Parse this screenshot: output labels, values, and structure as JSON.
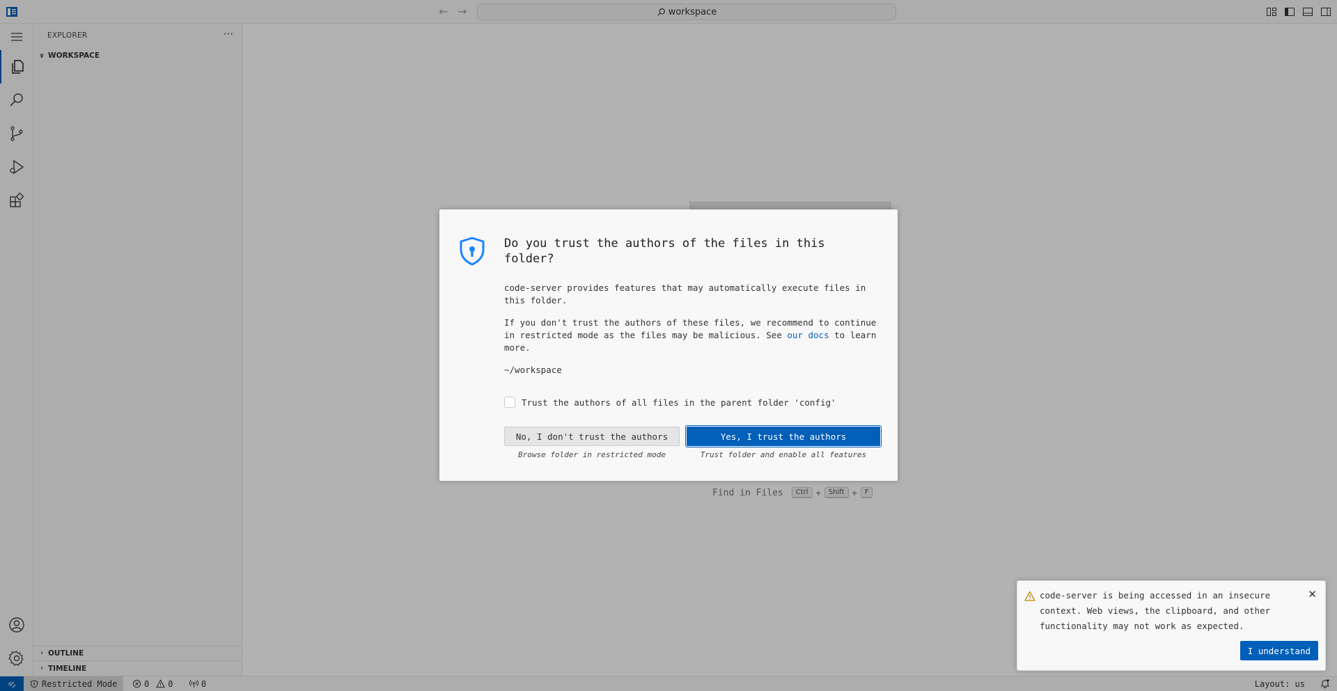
{
  "titlebar": {
    "search_text": "workspace"
  },
  "sidebar": {
    "title": "EXPLORER",
    "more": "···",
    "workspace_label": "WORKSPACE",
    "outline_label": "OUTLINE",
    "timeline_label": "TIMELINE"
  },
  "editor": {
    "find_in_files_label": "Find in Files",
    "keys": [
      "Ctrl",
      "Shift",
      "F"
    ]
  },
  "dialog": {
    "title": "Do you trust the authors of the files in this folder?",
    "para1": "code-server provides features that may automatically execute files in this folder.",
    "para2_before": "If you don't trust the authors of these files, we recommend to continue in restricted mode as the files may be malicious. See ",
    "para2_link": "our docs",
    "para2_after": " to learn more.",
    "path": "~/workspace",
    "checkbox_label": "Trust the authors of all files in the parent folder 'config'",
    "no_button": "No, I don't trust the authors",
    "no_caption": "Browse folder in restricted mode",
    "yes_button": "Yes, I trust the authors",
    "yes_caption": "Trust folder and enable all features"
  },
  "toast": {
    "message": "code-server is being accessed in an insecure context. Web views, the clipboard, and other functionality may not work as expected.",
    "button": "I understand"
  },
  "statusbar": {
    "restricted": "Restricted Mode",
    "errors": "0",
    "warnings": "0",
    "ports": "0",
    "layout": "Layout: us"
  },
  "colors": {
    "accent": "#005fb8",
    "warning": "#bf8803"
  }
}
